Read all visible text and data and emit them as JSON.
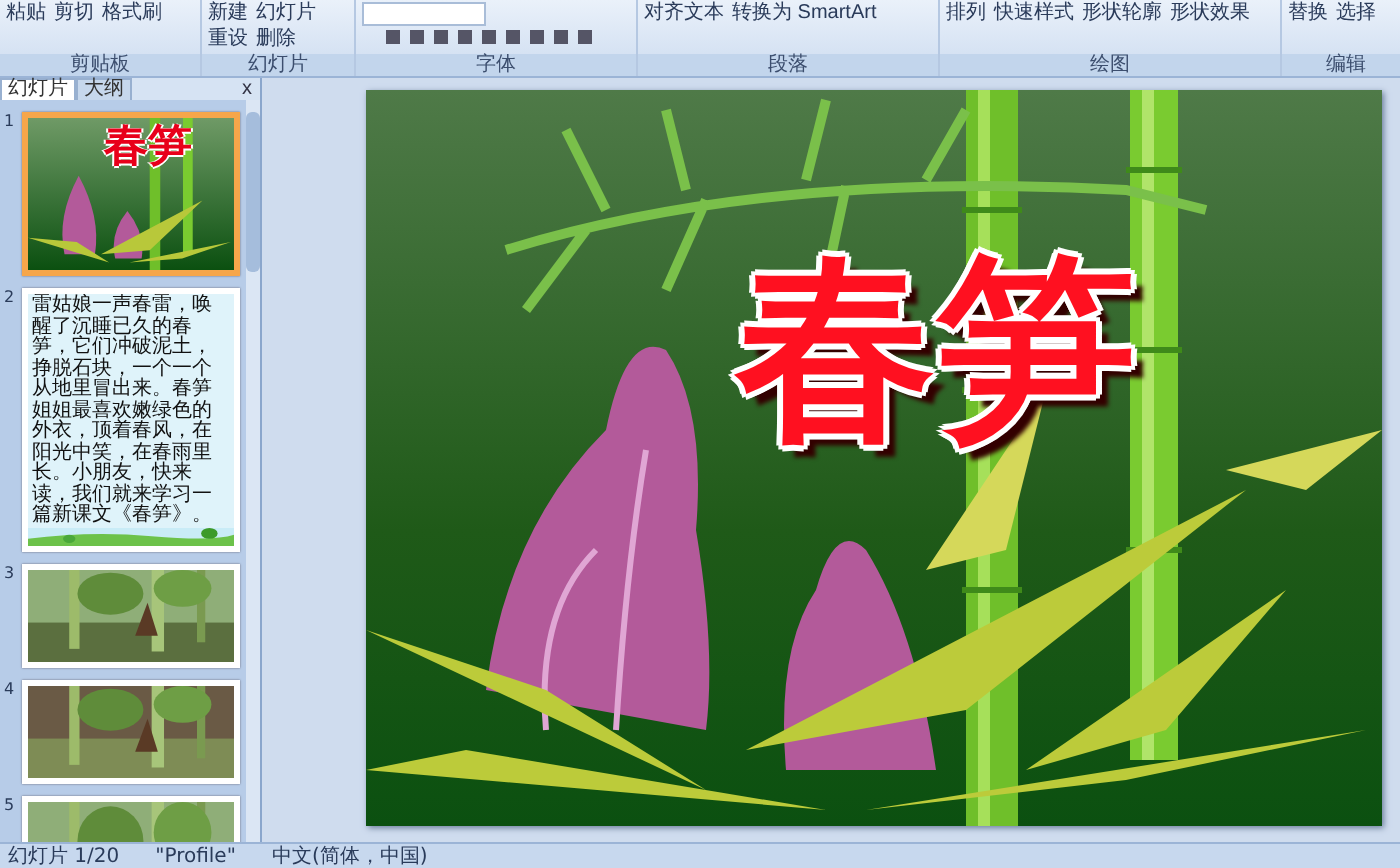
{
  "ribbon": {
    "groups": [
      {
        "label": "剪贴板",
        "buttons": [
          "粘贴",
          "剪切",
          "格式刷"
        ]
      },
      {
        "label": "幻灯片",
        "buttons": [
          "新建",
          "幻灯片",
          "重设",
          "删除"
        ]
      },
      {
        "label": "字体"
      },
      {
        "label": "段落",
        "buttons": [
          "对齐文本",
          "转换为 SmartArt"
        ]
      },
      {
        "label": "绘图",
        "buttons": [
          "排列",
          "快速样式",
          "形状轮廓",
          "形状效果"
        ]
      },
      {
        "label": "编辑",
        "buttons": [
          "替换",
          "选择"
        ]
      }
    ]
  },
  "panel": {
    "tabs": [
      {
        "label": "幻灯片",
        "selected": true
      },
      {
        "label": "大纲",
        "selected": false
      }
    ],
    "close": "x",
    "slides": [
      {
        "number": "1",
        "kind": "title",
        "selected": true,
        "title": "春笋"
      },
      {
        "number": "2",
        "kind": "text",
        "selected": false,
        "text": "雷姑娘一声春雷，唤醒了沉睡已久的春笋，它们冲破泥土，挣脱石块，一个一个从地里冒出来。春笋姐姐最喜欢嫩绿色的外衣，顶着春风，在阳光中笑，在春雨里长。小朋友，快来读，我们就来学习一篇新课文《春笋》。"
      },
      {
        "number": "3",
        "selected": false
      },
      {
        "number": "4",
        "selected": false
      },
      {
        "number": "5",
        "selected": false
      }
    ]
  },
  "slide": {
    "title": "春笋"
  },
  "status_bar": [
    "幻灯片 1/20",
    "\"Profile\"",
    "中文(简体，中国)"
  ]
}
